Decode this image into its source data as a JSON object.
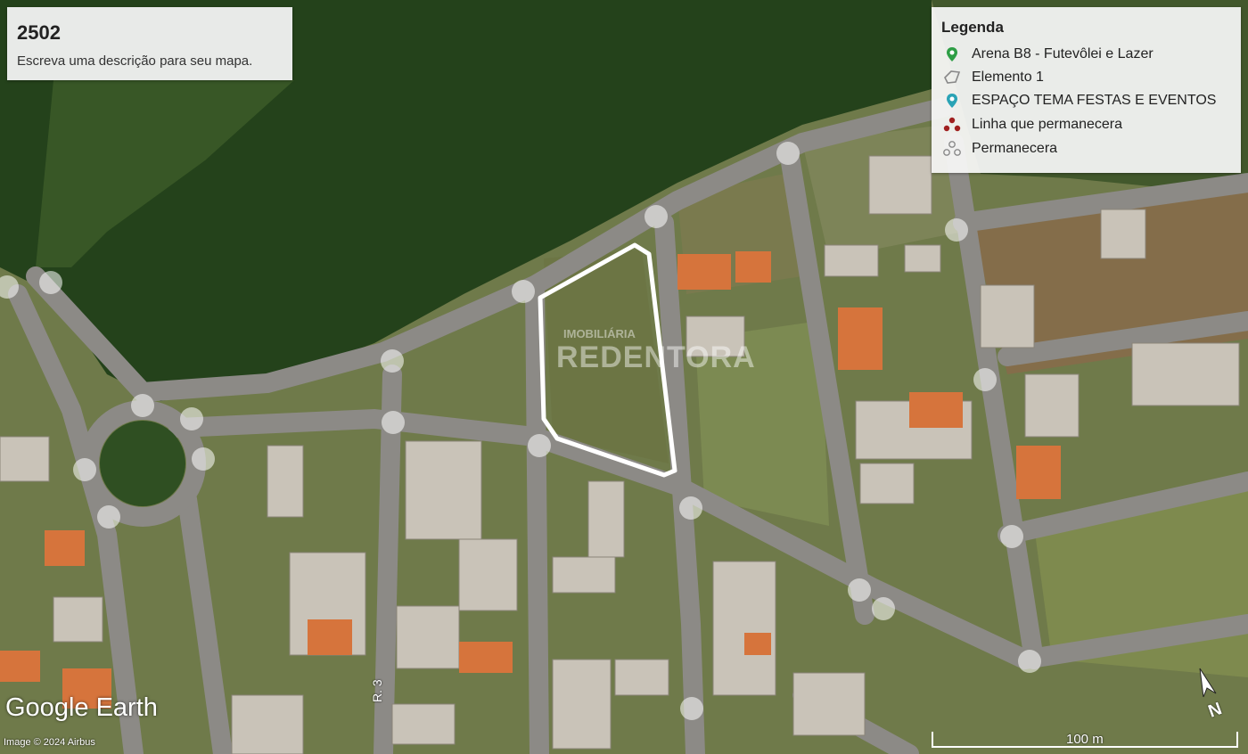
{
  "title_panel": {
    "title": "2502",
    "description": "Escreva uma descrição para seu mapa."
  },
  "legend": {
    "title": "Legenda",
    "items": [
      {
        "label": "Arena B8 - Futevôlei e Lazer",
        "icon": "green-pin-icon",
        "color": "#2e9e45"
      },
      {
        "label": "Elemento 1",
        "icon": "polygon-outline-icon",
        "color": "#888888"
      },
      {
        "label": "ESPAÇO TEMA FESTAS E EVENTOS",
        "icon": "teal-pin-icon",
        "color": "#2aa3b5"
      },
      {
        "label": "Linha que permanecera",
        "icon": "red-dots-icon",
        "color": "#a02020"
      },
      {
        "label": "Permanecera",
        "icon": "grey-dots-icon",
        "color": "#8a8a8a"
      }
    ]
  },
  "map": {
    "street_label": "R. 3",
    "watermark_line1": "IMOBILIÁRIA",
    "watermark_line2": "REDENTORA",
    "scale_label": "100 m",
    "branding": "Google Earth",
    "copyright": "Image © 2024 Airbus",
    "north_label": "N",
    "highlight_color": "#ffffff"
  }
}
